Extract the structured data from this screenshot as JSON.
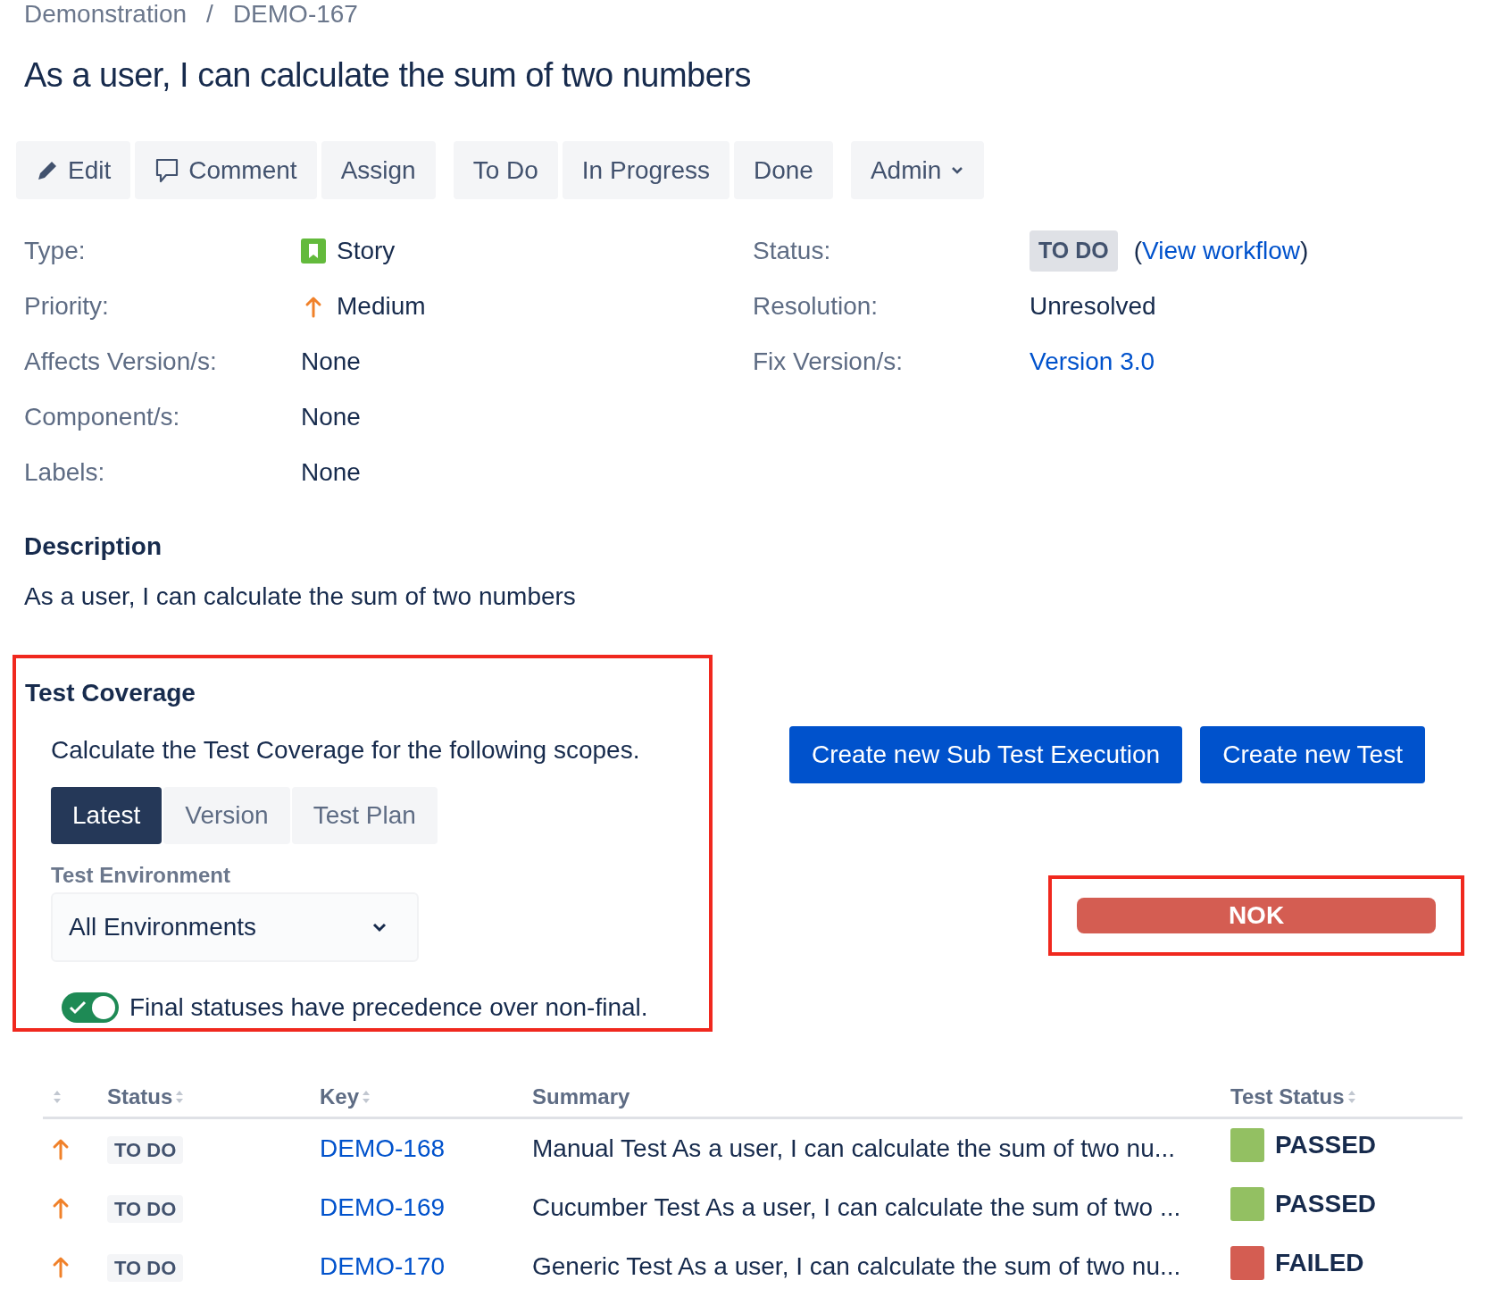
{
  "breadcrumb": {
    "project": "Demonstration",
    "separator": "/",
    "issue_key": "DEMO-167"
  },
  "title": "As a user, I can calculate the sum of two numbers",
  "toolbar": [
    {
      "label": "Edit"
    },
    {
      "label": "Comment"
    },
    {
      "label": "Assign"
    },
    {
      "label": "To Do"
    },
    {
      "label": "In Progress"
    },
    {
      "label": "Done"
    },
    {
      "label": "Admin",
      "dropdown": true
    }
  ],
  "fields_left": [
    {
      "label": "Type:",
      "value": "Story"
    },
    {
      "label": "Priority:",
      "value": "Medium"
    },
    {
      "label": "Affects Version/s:",
      "value": "None"
    },
    {
      "label": "Component/s:",
      "value": "None"
    },
    {
      "label": "Labels:",
      "value": "None"
    }
  ],
  "fields_right": [
    {
      "label": "Status:",
      "kind": "status",
      "value": "TO DO",
      "link_open": "(",
      "link": "View workflow",
      "link_close": ")"
    },
    {
      "label": "Resolution:",
      "kind": "text",
      "value": "Unresolved"
    },
    {
      "label": "Fix Version/s:",
      "kind": "link",
      "value": "Version 3.0"
    }
  ],
  "description": {
    "heading": "Description",
    "text": "As a user, I can calculate the sum of two numbers"
  },
  "test_coverage": {
    "heading": "Test Coverage",
    "intro": "Calculate the Test Coverage for the following scopes.",
    "scopes": [
      {
        "label": "Latest",
        "selected": true
      },
      {
        "label": "Version",
        "selected": false
      },
      {
        "label": "Test Plan",
        "selected": false
      }
    ],
    "environment_label": "Test Environment",
    "environment_value": "All Environments",
    "toggle": {
      "on": true,
      "label": "Final statuses have precedence over non-final."
    }
  },
  "actions": [
    "Create new Sub Test Execution",
    "Create new Test"
  ],
  "coverage_status": {
    "label": "NOK",
    "color": "#d45d52"
  },
  "table": {
    "columns": [
      {
        "sortable": true
      },
      {
        "label": "Status",
        "sortable": true
      },
      {
        "label": "Key",
        "sortable": true
      },
      {
        "label": "Summary",
        "sortable": false
      },
      {
        "label": "Test Status",
        "sortable": true
      }
    ],
    "rows": [
      {
        "status": "TO DO",
        "key": "DEMO-168",
        "summary": "Manual Test As a user, I can calculate the sum of two nu...",
        "test_status": "PASSED",
        "color": "#93c062"
      },
      {
        "status": "TO DO",
        "key": "DEMO-169",
        "summary": "Cucumber Test As a user, I can calculate the sum of two ...",
        "test_status": "PASSED",
        "color": "#93c062"
      },
      {
        "status": "TO DO",
        "key": "DEMO-170",
        "summary": "Generic Test As a user, I can calculate the sum of two nu...",
        "test_status": "FAILED",
        "color": "#d45d52"
      }
    ]
  }
}
